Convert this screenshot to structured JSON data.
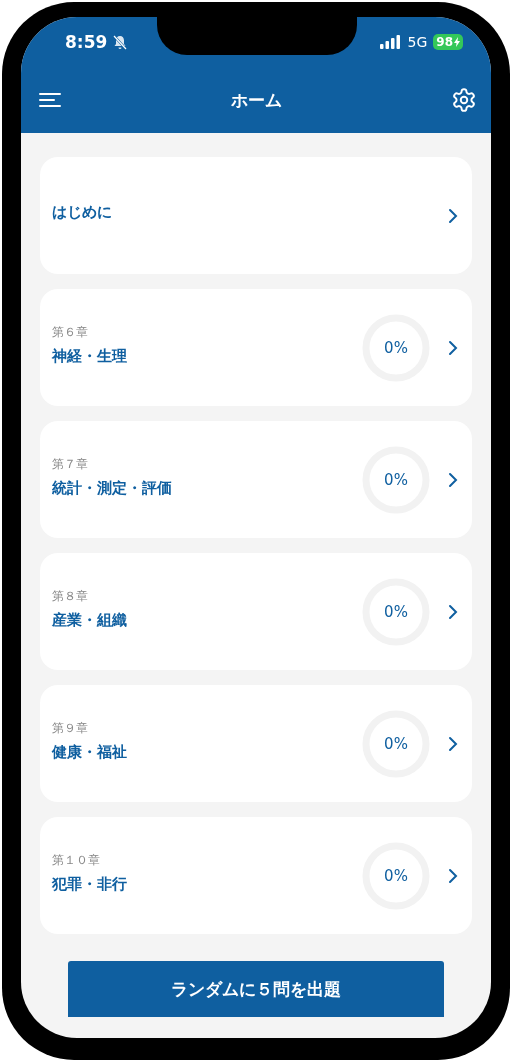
{
  "status_bar": {
    "time": "8:59",
    "network": "5G",
    "battery": "98"
  },
  "nav": {
    "title": "ホーム"
  },
  "items": [
    {
      "kind": "intro",
      "title": "はじめに"
    },
    {
      "kind": "chapter",
      "label": "第６章",
      "title": "神経・生理",
      "progress": {
        "reading": "0%"
      }
    },
    {
      "kind": "chapter",
      "label": "第７章",
      "title": "統計・測定・評価",
      "progress": {
        "reading": "0%"
      }
    },
    {
      "kind": "chapter",
      "label": "第８章",
      "title": "産業・組織",
      "progress": {
        "reading": "0%"
      }
    },
    {
      "kind": "chapter",
      "label": "第９章",
      "title": "健康・福祉",
      "progress": {
        "reading": "0%"
      }
    },
    {
      "kind": "chapter",
      "label": "第１０章",
      "title": "犯罪・非行",
      "progress": {
        "reading": "0%"
      }
    }
  ],
  "random_button": "ランダムに５問を出題"
}
